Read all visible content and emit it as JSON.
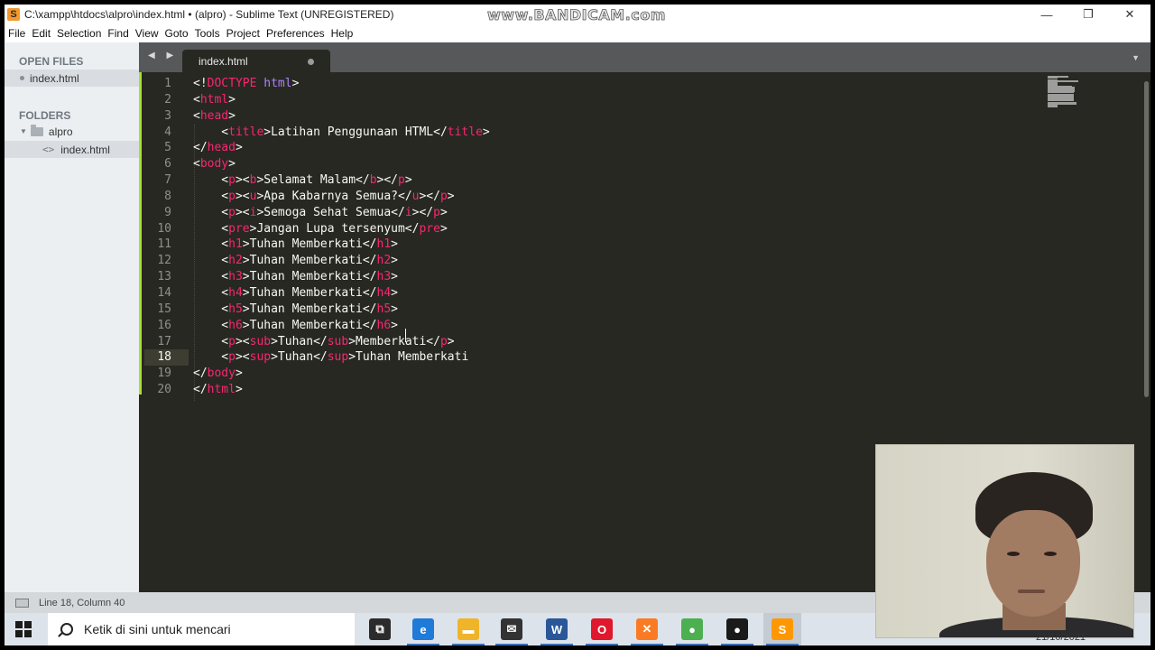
{
  "window": {
    "title": "C:\\xampp\\htdocs\\alpro\\index.html • (alpro) - Sublime Text (UNREGISTERED)",
    "watermark": "www.BANDICAM.com",
    "controls": {
      "minimize": "—",
      "restore": "❐",
      "close": "✕"
    }
  },
  "menu": [
    "File",
    "Edit",
    "Selection",
    "Find",
    "View",
    "Goto",
    "Tools",
    "Project",
    "Preferences",
    "Help"
  ],
  "sidebar": {
    "open_files_heading": "OPEN FILES",
    "open_files": [
      {
        "label": "index.html"
      }
    ],
    "folders_heading": "FOLDERS",
    "folder": {
      "label": "alpro"
    },
    "folder_files": [
      {
        "label": "index.html"
      }
    ]
  },
  "tabs": {
    "nav_arrows": "◀ ▶",
    "active": {
      "label": "index.html",
      "modified": true
    },
    "menu_glyph": "▼"
  },
  "editor": {
    "current_line": 18,
    "line_numbers": [
      "1",
      "2",
      "3",
      "4",
      "5",
      "6",
      "7",
      "8",
      "9",
      "10",
      "11",
      "12",
      "13",
      "14",
      "15",
      "16",
      "17",
      "18",
      "19",
      "20"
    ],
    "lines": [
      [
        [
          "tk",
          "<!"
        ],
        [
          "tg",
          "DOCTYPE"
        ],
        [
          "tk",
          " "
        ],
        [
          "kw",
          "html"
        ],
        [
          "tk",
          ">"
        ]
      ],
      [
        [
          "tk",
          "<"
        ],
        [
          "tg",
          "html"
        ],
        [
          "tk",
          ">"
        ]
      ],
      [
        [
          "tk",
          "<"
        ],
        [
          "tg",
          "head"
        ],
        [
          "tk",
          ">"
        ]
      ],
      [
        [
          "tk",
          "    <"
        ],
        [
          "tg",
          "title"
        ],
        [
          "tk",
          ">Latihan Penggunaan HTML</"
        ],
        [
          "tg",
          "title"
        ],
        [
          "tk",
          ">"
        ]
      ],
      [
        [
          "tk",
          "</"
        ],
        [
          "tg",
          "head"
        ],
        [
          "tk",
          ">"
        ]
      ],
      [
        [
          "tk",
          "<"
        ],
        [
          "tg",
          "body"
        ],
        [
          "tk",
          ">"
        ]
      ],
      [
        [
          "tk",
          "    <"
        ],
        [
          "tg",
          "p"
        ],
        [
          "tk",
          "><"
        ],
        [
          "tg",
          "b"
        ],
        [
          "tk",
          ">Selamat Malam</"
        ],
        [
          "tg",
          "b"
        ],
        [
          "tk",
          "></"
        ],
        [
          "tg",
          "p"
        ],
        [
          "tk",
          ">"
        ]
      ],
      [
        [
          "tk",
          "    <"
        ],
        [
          "tg",
          "p"
        ],
        [
          "tk",
          "><"
        ],
        [
          "tg",
          "u"
        ],
        [
          "tk",
          ">Apa Kabarnya Semua?</"
        ],
        [
          "tg",
          "u"
        ],
        [
          "tk",
          "></"
        ],
        [
          "tg",
          "p"
        ],
        [
          "tk",
          ">"
        ]
      ],
      [
        [
          "tk",
          "    <"
        ],
        [
          "tg",
          "p"
        ],
        [
          "tk",
          "><"
        ],
        [
          "tg",
          "i"
        ],
        [
          "tk",
          ">Semoga Sehat Semua</"
        ],
        [
          "tg",
          "i"
        ],
        [
          "tk",
          "></"
        ],
        [
          "tg",
          "p"
        ],
        [
          "tk",
          ">"
        ]
      ],
      [
        [
          "tk",
          "    <"
        ],
        [
          "tg",
          "pre"
        ],
        [
          "tk",
          ">Jangan Lupa tersenyum</"
        ],
        [
          "tg",
          "pre"
        ],
        [
          "tk",
          ">"
        ]
      ],
      [
        [
          "tk",
          "    <"
        ],
        [
          "tg",
          "h1"
        ],
        [
          "tk",
          ">Tuhan Memberkati</"
        ],
        [
          "tg",
          "h1"
        ],
        [
          "tk",
          ">"
        ]
      ],
      [
        [
          "tk",
          "    <"
        ],
        [
          "tg",
          "h2"
        ],
        [
          "tk",
          ">Tuhan Memberkati</"
        ],
        [
          "tg",
          "h2"
        ],
        [
          "tk",
          ">"
        ]
      ],
      [
        [
          "tk",
          "    <"
        ],
        [
          "tg",
          "h3"
        ],
        [
          "tk",
          ">Tuhan Memberkati</"
        ],
        [
          "tg",
          "h3"
        ],
        [
          "tk",
          ">"
        ]
      ],
      [
        [
          "tk",
          "    <"
        ],
        [
          "tg",
          "h4"
        ],
        [
          "tk",
          ">Tuhan Memberkati</"
        ],
        [
          "tg",
          "h4"
        ],
        [
          "tk",
          ">"
        ]
      ],
      [
        [
          "tk",
          "    <"
        ],
        [
          "tg",
          "h5"
        ],
        [
          "tk",
          ">Tuhan Memberkati</"
        ],
        [
          "tg",
          "h5"
        ],
        [
          "tk",
          ">"
        ]
      ],
      [
        [
          "tk",
          "    <"
        ],
        [
          "tg",
          "h6"
        ],
        [
          "tk",
          ">Tuhan Memberkati</"
        ],
        [
          "tg",
          "h6"
        ],
        [
          "tk",
          ">"
        ]
      ],
      [
        [
          "tk",
          "    <"
        ],
        [
          "tg",
          "p"
        ],
        [
          "tk",
          "><"
        ],
        [
          "tg",
          "sub"
        ],
        [
          "tk",
          ">Tuhan</"
        ],
        [
          "tg",
          "sub"
        ],
        [
          "tk",
          ">Memberkati</"
        ],
        [
          "tg",
          "p"
        ],
        [
          "tk",
          ">"
        ]
      ],
      [
        [
          "tk",
          "    <"
        ],
        [
          "tg",
          "p"
        ],
        [
          "tk",
          "><"
        ],
        [
          "tg",
          "sup"
        ],
        [
          "tk",
          ">Tuhan</"
        ],
        [
          "tg",
          "sup"
        ],
        [
          "tk",
          ">Tuhan Memberkati"
        ]
      ],
      [
        [
          "tk",
          "</"
        ],
        [
          "tg",
          "body"
        ],
        [
          "tk",
          ">"
        ]
      ],
      [
        [
          "tk",
          "</"
        ],
        [
          "tg",
          "html"
        ],
        [
          "tk",
          ">"
        ]
      ]
    ]
  },
  "status": {
    "position": "Line 18, Column 40"
  },
  "taskbar": {
    "search_placeholder": "Ketik di sini untuk mencari",
    "apps": [
      {
        "name": "task-view",
        "glyph": "⧉",
        "color": "#2b2b2b"
      },
      {
        "name": "edge",
        "glyph": "e",
        "color": "#1f7ad8"
      },
      {
        "name": "file-explorer",
        "glyph": "▬",
        "color": "#f0b429"
      },
      {
        "name": "mail",
        "glyph": "✉",
        "color": "#333333"
      },
      {
        "name": "word",
        "glyph": "W",
        "color": "#2b579a"
      },
      {
        "name": "opera",
        "glyph": "O",
        "color": "#e0182d"
      },
      {
        "name": "xampp",
        "glyph": "✕",
        "color": "#fb7a24"
      },
      {
        "name": "chrome",
        "glyph": "●",
        "color": "#4caf50"
      },
      {
        "name": "bandicam",
        "glyph": "●",
        "color": "#1a1a1a"
      },
      {
        "name": "sublime-text",
        "glyph": "S",
        "color": "#ff9800"
      }
    ],
    "clock_date": "21/10/2021"
  },
  "colors": {
    "editor_bg": "#272822",
    "tag": "#f92672",
    "keyword": "#ae81ff",
    "text": "#f8f8f2",
    "modified_marker": "#a6e22e"
  }
}
